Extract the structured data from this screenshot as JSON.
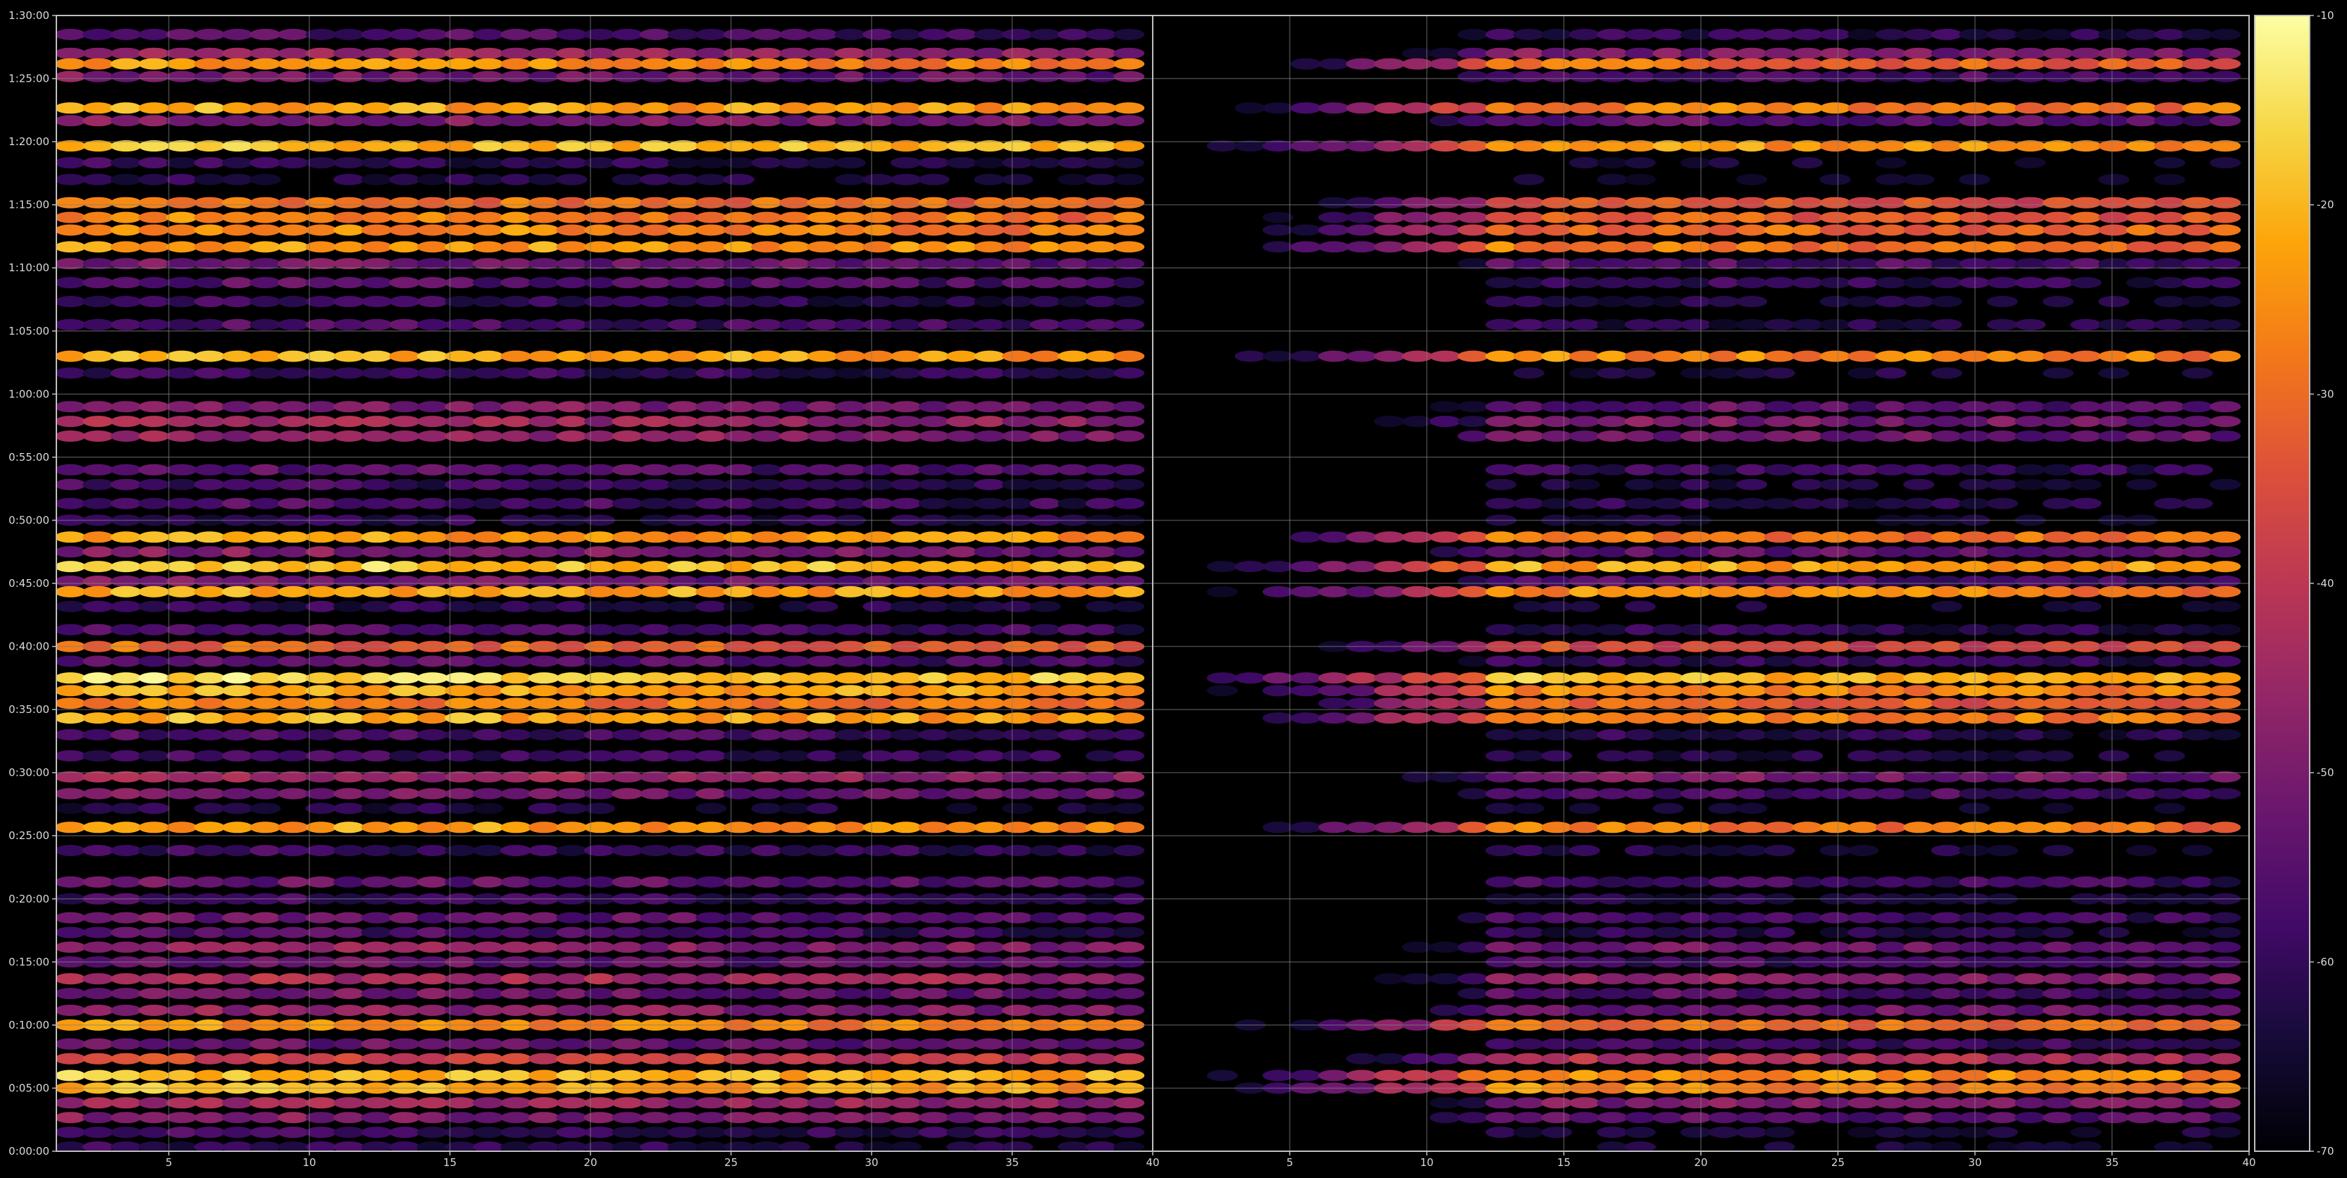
{
  "chart_data": {
    "type": "heatmap",
    "title": "",
    "panels": [
      {
        "name": "",
        "x": {
          "range": [
            1,
            40
          ],
          "ticks": [
            5,
            10,
            15,
            20,
            25,
            30,
            35,
            40
          ],
          "tick_labels": [
            "5",
            "10",
            "15",
            "20",
            "25",
            "30",
            "35",
            "40"
          ]
        },
        "pattern": "full"
      },
      {
        "name": "",
        "x": {
          "range": [
            0,
            40
          ],
          "ticks": [
            5,
            10,
            15,
            20,
            25,
            30,
            35,
            40
          ],
          "tick_labels": [
            "5",
            "10",
            "15",
            "20",
            "25",
            "30",
            "35",
            "40"
          ]
        },
        "pattern": "rises_with_x"
      }
    ],
    "y": {
      "range_seconds": [
        0,
        5400
      ],
      "ticks_seconds": [
        0,
        300,
        600,
        900,
        1200,
        1500,
        1800,
        2100,
        2400,
        2700,
        3000,
        3300,
        3600,
        3900,
        4200,
        4500,
        4800,
        5100,
        5400
      ],
      "tick_labels": [
        "0:00:00",
        "0:05:00",
        "0:10:00",
        "0:15:00",
        "0:20:00",
        "0:25:00",
        "0:30:00",
        "0:35:00",
        "0:40:00",
        "0:45:00",
        "0:50:00",
        "0:55:00",
        "1:00:00",
        "1:05:00",
        "1:10:00",
        "1:15:00",
        "1:20:00",
        "1:25:00",
        "1:30:00"
      ]
    },
    "colorbar": {
      "colormap": "inferno",
      "range": [
        -70,
        -10
      ],
      "ticks": [
        -70,
        -60,
        -50,
        -40,
        -30,
        -20,
        -10
      ],
      "tick_labels": [
        "-70",
        "-60",
        "-50",
        "-40",
        "-30",
        "-20",
        "-10"
      ]
    },
    "rows": [
      {
        "t": 5310,
        "level": -55
      },
      {
        "t": 5220,
        "level": -44
      },
      {
        "t": 5170,
        "level": -24
      },
      {
        "t": 5110,
        "level": -50
      },
      {
        "t": 4960,
        "level": -21
      },
      {
        "t": 4900,
        "level": -48
      },
      {
        "t": 4780,
        "level": -18
      },
      {
        "t": 4700,
        "level": -60
      },
      {
        "t": 4620,
        "level": -62
      },
      {
        "t": 4510,
        "level": -28
      },
      {
        "t": 4440,
        "level": -26
      },
      {
        "t": 4380,
        "level": -24
      },
      {
        "t": 4300,
        "level": -22
      },
      {
        "t": 4220,
        "level": -50
      },
      {
        "t": 4130,
        "level": -54
      },
      {
        "t": 4040,
        "level": -58
      },
      {
        "t": 3930,
        "level": -56
      },
      {
        "t": 3780,
        "level": -20
      },
      {
        "t": 3700,
        "level": -58
      },
      {
        "t": 3540,
        "level": -48
      },
      {
        "t": 3470,
        "level": -44
      },
      {
        "t": 3400,
        "level": -46
      },
      {
        "t": 3240,
        "level": -54
      },
      {
        "t": 3170,
        "level": -58
      },
      {
        "t": 3080,
        "level": -56
      },
      {
        "t": 3000,
        "level": -60
      },
      {
        "t": 2920,
        "level": -22
      },
      {
        "t": 2850,
        "level": -48
      },
      {
        "t": 2780,
        "level": -16
      },
      {
        "t": 2710,
        "level": -50
      },
      {
        "t": 2660,
        "level": -20
      },
      {
        "t": 2590,
        "level": -60
      },
      {
        "t": 2480,
        "level": -55
      },
      {
        "t": 2400,
        "level": -30
      },
      {
        "t": 2330,
        "level": -54
      },
      {
        "t": 2250,
        "level": -14
      },
      {
        "t": 2190,
        "level": -20
      },
      {
        "t": 2130,
        "level": -26
      },
      {
        "t": 2060,
        "level": -20
      },
      {
        "t": 1980,
        "level": -56
      },
      {
        "t": 1880,
        "level": -58
      },
      {
        "t": 1780,
        "level": -44
      },
      {
        "t": 1700,
        "level": -50
      },
      {
        "t": 1630,
        "level": -62
      },
      {
        "t": 1540,
        "level": -22
      },
      {
        "t": 1430,
        "level": -58
      },
      {
        "t": 1280,
        "level": -52
      },
      {
        "t": 1200,
        "level": -58
      },
      {
        "t": 1110,
        "level": -52
      },
      {
        "t": 1040,
        "level": -56
      },
      {
        "t": 970,
        "level": -46
      },
      {
        "t": 900,
        "level": -52
      },
      {
        "t": 820,
        "level": -42
      },
      {
        "t": 750,
        "level": -50
      },
      {
        "t": 670,
        "level": -46
      },
      {
        "t": 600,
        "level": -24
      },
      {
        "t": 510,
        "level": -52
      },
      {
        "t": 440,
        "level": -36
      },
      {
        "t": 360,
        "level": -18
      },
      {
        "t": 300,
        "level": -20
      },
      {
        "t": 230,
        "level": -44
      },
      {
        "t": 160,
        "level": -48
      },
      {
        "t": 90,
        "level": -58
      },
      {
        "t": 20,
        "level": -60
      }
    ]
  }
}
